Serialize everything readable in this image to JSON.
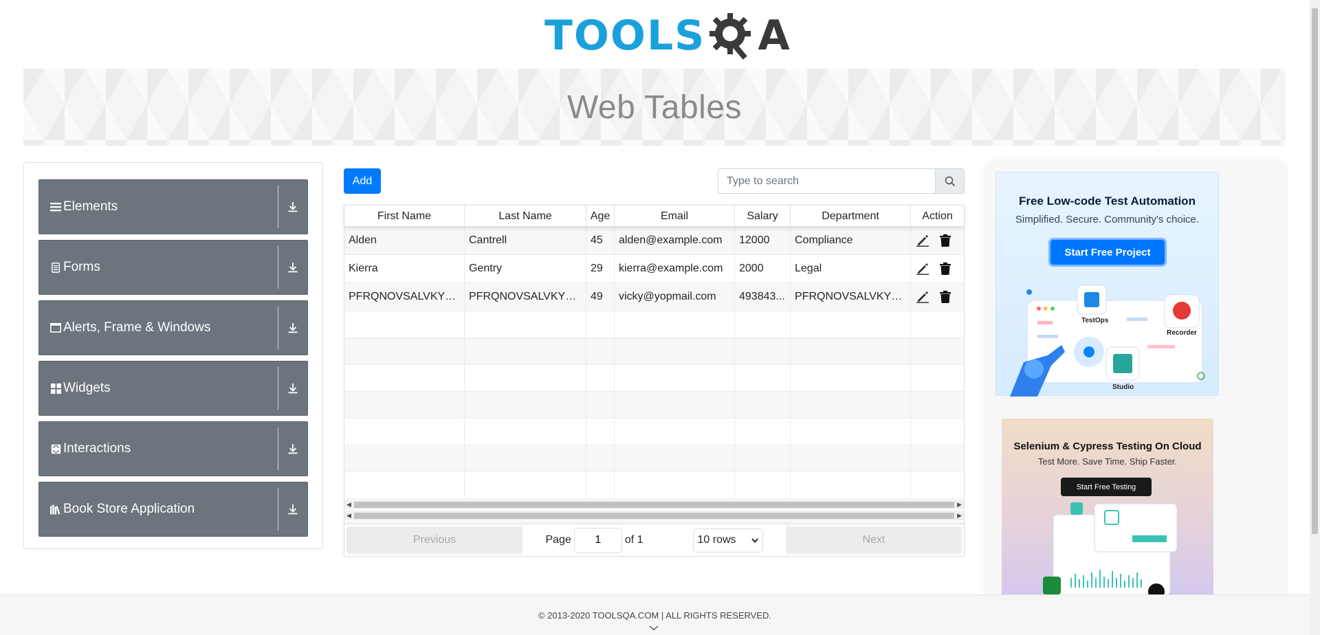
{
  "logo": {
    "part1": "TOOLS",
    "part2": "A"
  },
  "banner": {
    "title": "Web Tables"
  },
  "sidebar": {
    "groups": [
      {
        "label": "Elements",
        "icon": "menu-icon"
      },
      {
        "label": "Forms",
        "icon": "document-icon"
      },
      {
        "label": "Alerts, Frame & Windows",
        "icon": "window-icon"
      },
      {
        "label": "Widgets",
        "icon": "widgets-icon"
      },
      {
        "label": "Interactions",
        "icon": "interactions-icon"
      },
      {
        "label": "Book Store Application",
        "icon": "books-icon"
      }
    ]
  },
  "toolbar": {
    "add_label": "Add",
    "search_placeholder": "Type to search"
  },
  "table": {
    "headers": [
      "First Name",
      "Last Name",
      "Age",
      "Email",
      "Salary",
      "Department",
      "Action"
    ],
    "rows": [
      [
        "Alden",
        "Cantrell",
        "45",
        "alden@example.com",
        "12000",
        "Compliance"
      ],
      [
        "Kierra",
        "Gentry",
        "29",
        "kierra@example.com",
        "2000",
        "Legal"
      ],
      [
        "PFRQNOVSALVKYTZ...",
        "PFRQNOVSALVKYTZ...",
        "49",
        "vicky@yopmail.com",
        "493843...",
        "PFRQNOVSALVKYTZ..."
      ]
    ],
    "empty_rows": 7
  },
  "pagination": {
    "previous_label": "Previous",
    "next_label": "Next",
    "page_label": "Page",
    "page_value": "1",
    "of_label": "of 1",
    "rows_option": "10 rows"
  },
  "ads": {
    "ad1": {
      "title": "Free Low-code Test Automation",
      "subtitle": "Simplified. Secure. Community's choice.",
      "cta": "Start Free Project",
      "labels": [
        "TestOps",
        "Recorder",
        "Studio"
      ]
    },
    "ad2": {
      "title": "Selenium & Cypress Testing On Cloud",
      "subtitle": "Test More. Save Time. Ship Faster.",
      "cta": "Start Free Testing"
    }
  },
  "footer": {
    "copyright": "© 2013-2020 TOOLSQA.COM | ALL RIGHTS RESERVED."
  },
  "colors": {
    "brand_blue": "#1aa1db",
    "primary": "#007bff",
    "sidebar": "#6c757d"
  }
}
